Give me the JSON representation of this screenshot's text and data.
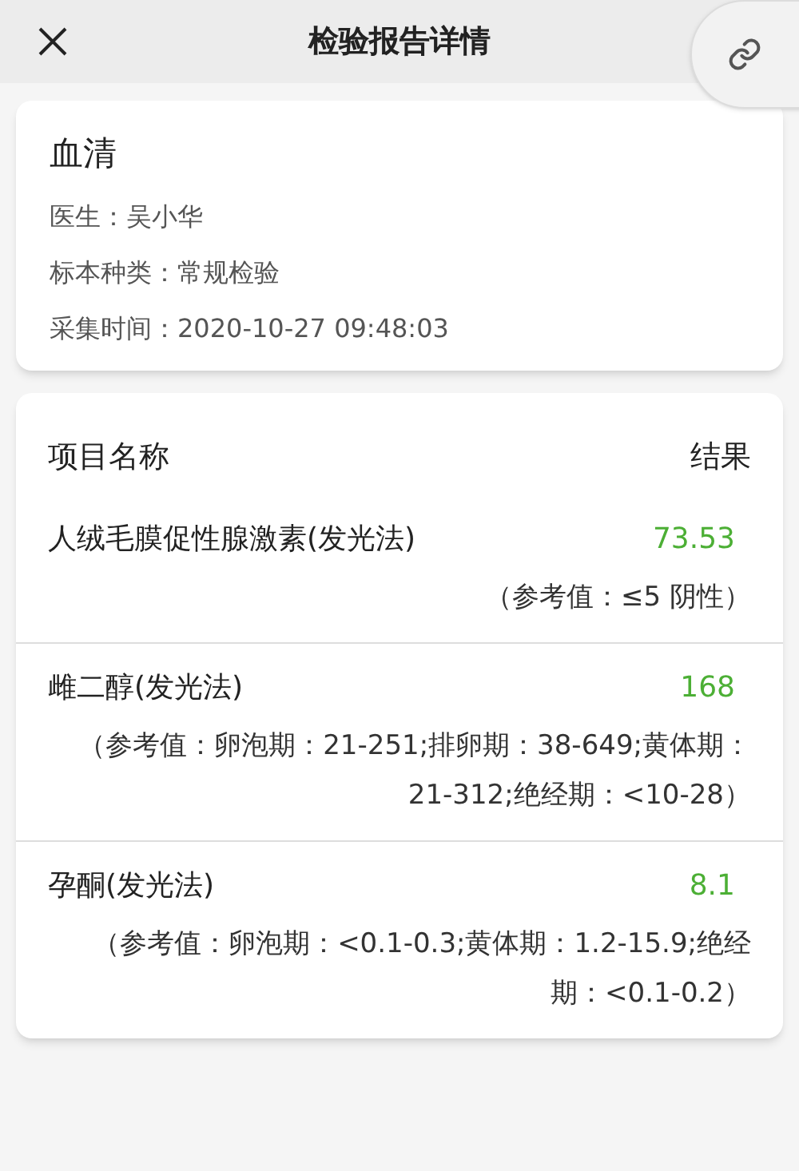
{
  "header": {
    "title": "检验报告详情"
  },
  "sample": {
    "title": "血清",
    "fields": [
      {
        "label": "医生：",
        "value": "吴小华"
      },
      {
        "label": "标本种类：",
        "value": "常规检验"
      },
      {
        "label": "采集时间：",
        "value": "2020-10-27 09:48:03"
      }
    ]
  },
  "table": {
    "columns": [
      "项目名称",
      "结果"
    ],
    "rows": [
      {
        "name": "人绒毛膜促性腺激素(发光法)",
        "result": "73.53",
        "reference": "（参考值：≤5 阴性）"
      },
      {
        "name": "雌二醇(发光法)",
        "result": "168",
        "reference": "（参考值：卵泡期：21-251;排卵期：38-649;黄体期：21-312;绝经期：<10-28）"
      },
      {
        "name": "孕酮(发光法)",
        "result": "8.1",
        "reference": "（参考值：卵泡期：<0.1-0.3;黄体期：1.2-15.9;绝经期：<0.1-0.2）"
      }
    ]
  }
}
